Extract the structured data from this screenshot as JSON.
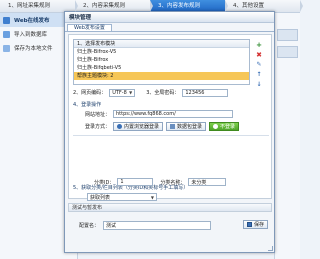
{
  "steps": [
    {
      "label": "1、网址采集规则",
      "active": false
    },
    {
      "label": "2、内容采集规则",
      "active": false
    },
    {
      "label": "3、内容发布规则",
      "active": true
    },
    {
      "label": "4、其他设置",
      "active": false
    }
  ],
  "nav": {
    "items": [
      {
        "label": "Web在线发布",
        "active": true
      },
      {
        "label": "导入到数据库",
        "active": false
      },
      {
        "label": "保存为本地文件",
        "active": false
      }
    ]
  },
  "dialog": {
    "title": "模块管理",
    "tab": "Web发布设置",
    "module_list": {
      "header": "1、选择发布模块",
      "rows": [
        "归土族-Bifrox-V5",
        "归土族-Bifrox",
        "归土族-Bifqbeti-V5",
        "帮族主题模块: 2"
      ],
      "selected_index": 3
    },
    "tools": {
      "add": "+",
      "delete": "✖",
      "edit": "✎",
      "up": "↑",
      "down": "↓"
    },
    "encoding": {
      "label": "2、网页编码：",
      "value": "UTF-8",
      "password_label": "3、全局密码：",
      "password_value": "123456"
    },
    "login": {
      "section": "4、登录操作",
      "url_label": "网站地址：",
      "url_value": "https://www.fq868.com/",
      "method_label": "登录方式：",
      "btn_browser": "内置浏览器登录",
      "btn_packet": "数据包登录",
      "btn_nologin": "不登录"
    },
    "category": {
      "section": "5、获取分类/栏目列表（分类ID和类标号手工填写）",
      "fetch_label": "获取列表",
      "id_label": "分类ID：",
      "id_value": "1",
      "name_label": "分类名称：",
      "name_value": "未分类"
    },
    "bottom": {
      "header": "测试与暂发布",
      "name_label": "配置名：",
      "name_value": "测试",
      "save_label": "保存"
    }
  }
}
